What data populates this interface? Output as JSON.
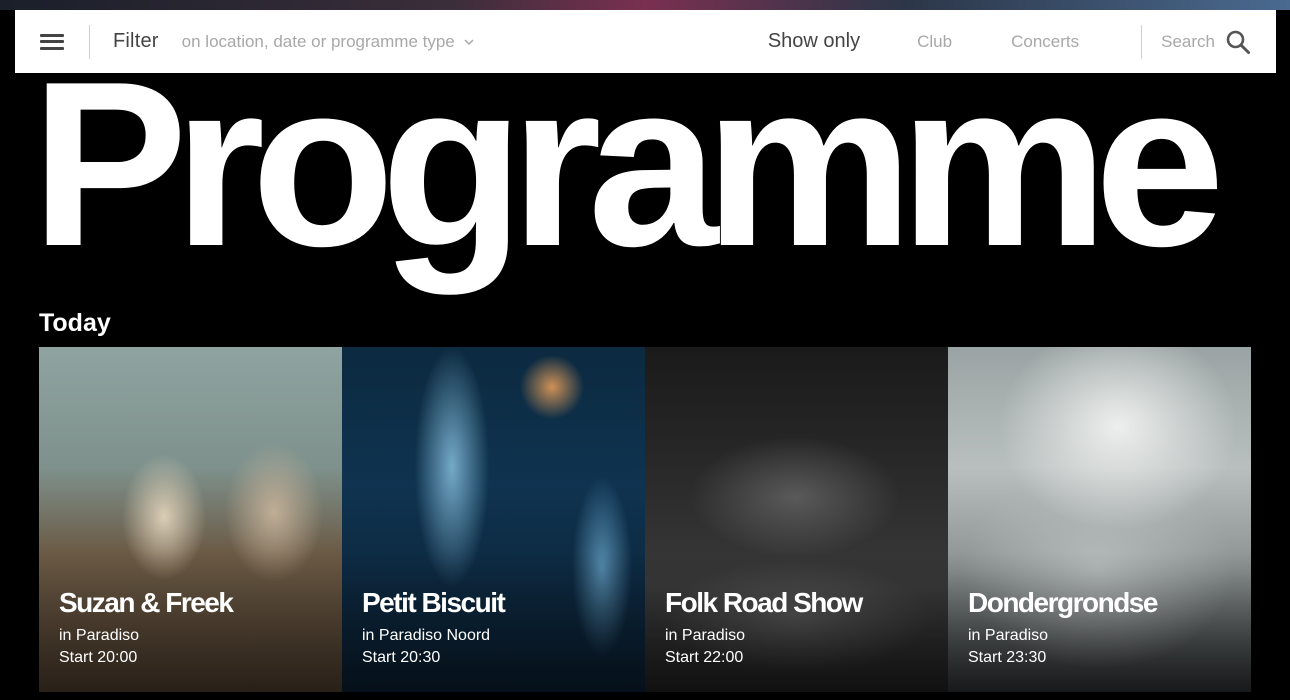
{
  "filter_bar": {
    "filter_label": "Filter",
    "filter_placeholder": "on location, date or programme type",
    "show_only_label": "Show only",
    "toggles": [
      "Club",
      "Concerts"
    ],
    "search_label": "Search"
  },
  "page": {
    "title": "Programme",
    "section_title": "Today"
  },
  "events": [
    {
      "name": "Suzan & Freek",
      "venue": "in Paradiso",
      "start": "Start 20:00"
    },
    {
      "name": "Petit Biscuit",
      "venue": "in Paradiso Noord",
      "start": "Start 20:30"
    },
    {
      "name": "Folk Road Show",
      "venue": "in Paradiso",
      "start": "Start 22:00"
    },
    {
      "name": "Dondergrondse",
      "venue": "in Paradiso",
      "start": "Start 23:30"
    }
  ],
  "icons": {
    "menu": "hamburger-icon",
    "filter_dropdown": "chevron-down-icon",
    "search": "search-icon"
  },
  "colors": {
    "background": "#000000",
    "bar": "#ffffff",
    "muted_text": "#a8a8a8",
    "strong_text": "#444444"
  }
}
